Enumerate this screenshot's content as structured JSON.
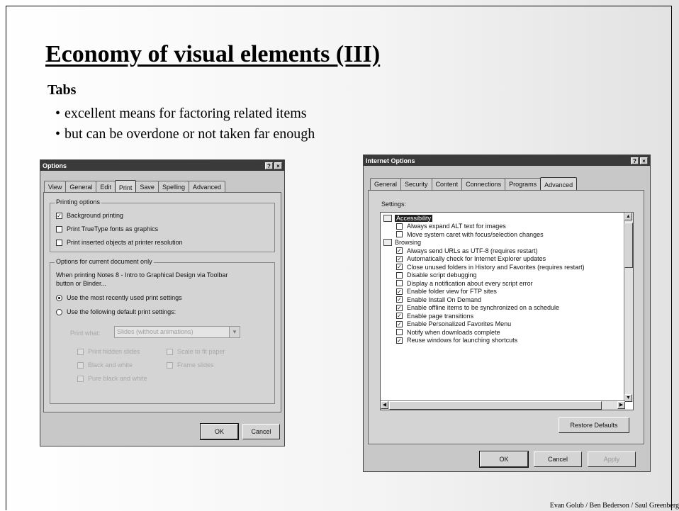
{
  "slide": {
    "title": "Economy of visual elements (III)",
    "subhead": "Tabs",
    "bullets": [
      "excellent means for factoring related items",
      "but can be overdone or not taken far enough"
    ],
    "credit": "Evan Golub / Ben Bederson / Saul Greenberg"
  },
  "options_dialog": {
    "title": "Options",
    "title_buttons": [
      "?",
      "×"
    ],
    "tabs": [
      "View",
      "General",
      "Edit",
      "Print",
      "Save",
      "Spelling",
      "Advanced"
    ],
    "active_tab": "Print",
    "printing_group": {
      "label": "Printing options",
      "items": [
        {
          "label": "Background printing",
          "checked": true
        },
        {
          "label": "Print TrueType fonts as graphics",
          "checked": false
        },
        {
          "label": "Print inserted objects at printer resolution",
          "checked": false
        }
      ]
    },
    "current_doc_group": {
      "label": "Options for current document only",
      "description_line1": "When printing Notes 8 - Intro to Graphical Design via Toolbar",
      "description_line2": "button or Binder...",
      "radios": [
        {
          "label": "Use the most recently used print settings",
          "selected": true
        },
        {
          "label": "Use the following default print settings:",
          "selected": false
        }
      ],
      "print_what_label": "Print what:",
      "print_what_value": "Slides (without animations)",
      "disabled_options": [
        "Print hidden slides",
        "Scale to fit paper",
        "Black and white",
        "Frame slides",
        "Pure black and white"
      ]
    },
    "ok_label": "OK",
    "cancel_label": "Cancel"
  },
  "internet_options_dialog": {
    "title": "Internet Options",
    "title_buttons": [
      "?",
      "×"
    ],
    "tabs": [
      "General",
      "Security",
      "Content",
      "Connections",
      "Programs",
      "Advanced"
    ],
    "active_tab": "Advanced",
    "settings_label": "Settings:",
    "settings": [
      {
        "kind": "category",
        "label": "Accessibility",
        "highlighted": true
      },
      {
        "kind": "option",
        "label": "Always expand ALT text for images",
        "checked": false
      },
      {
        "kind": "option",
        "label": "Move system caret with focus/selection changes",
        "checked": false
      },
      {
        "kind": "category",
        "label": "Browsing",
        "highlighted": false
      },
      {
        "kind": "option",
        "label": "Always send URLs as UTF-8 (requires restart)",
        "checked": true
      },
      {
        "kind": "option",
        "label": "Automatically check for Internet Explorer updates",
        "checked": true
      },
      {
        "kind": "option",
        "label": "Close unused folders in History and Favorites (requires restart)",
        "checked": true
      },
      {
        "kind": "option",
        "label": "Disable script debugging",
        "checked": false
      },
      {
        "kind": "option",
        "label": "Display a notification about every script error",
        "checked": false
      },
      {
        "kind": "option",
        "label": "Enable folder view for FTP sites",
        "checked": true
      },
      {
        "kind": "option",
        "label": "Enable Install On Demand",
        "checked": true
      },
      {
        "kind": "option",
        "label": "Enable offline items to be synchronized on a schedule",
        "checked": true
      },
      {
        "kind": "option",
        "label": "Enable page transitions",
        "checked": true
      },
      {
        "kind": "option",
        "label": "Enable Personalized Favorites Menu",
        "checked": true
      },
      {
        "kind": "option",
        "label": "Notify when downloads complete",
        "checked": false
      },
      {
        "kind": "option",
        "label": "Reuse windows for launching shortcuts",
        "checked": true
      }
    ],
    "restore_defaults_label": "Restore Defaults",
    "ok_label": "OK",
    "cancel_label": "Cancel",
    "apply_label": "Apply"
  }
}
